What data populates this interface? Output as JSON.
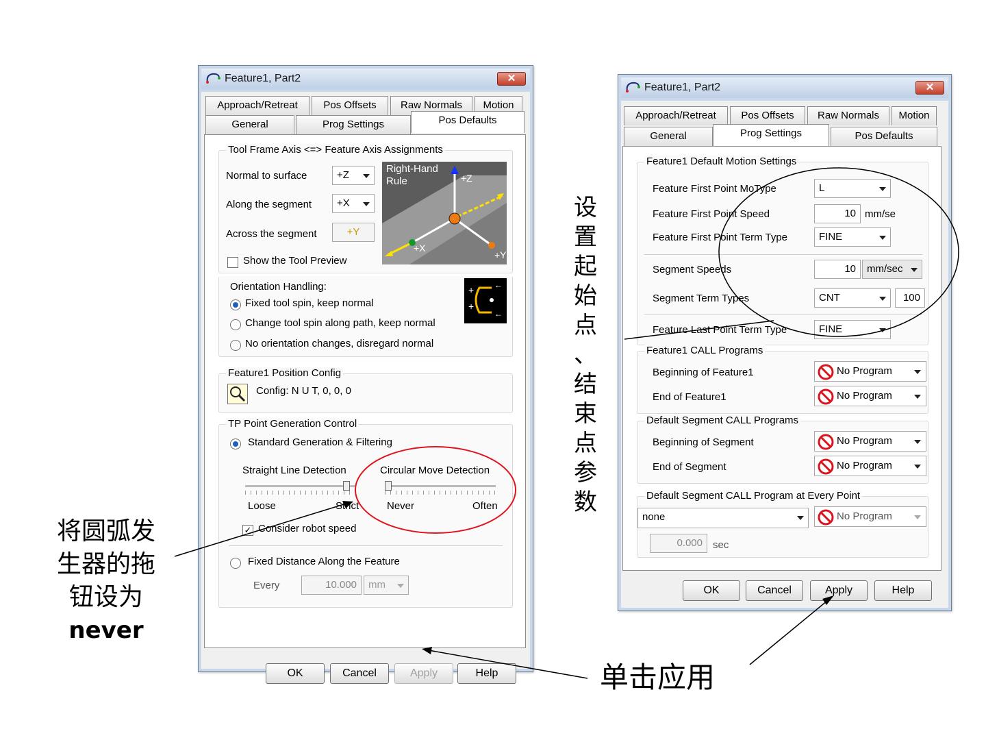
{
  "left_dialog": {
    "title": "Feature1, Part2",
    "close_label": "✕",
    "tabs_row1": [
      "Approach/Retreat",
      "Pos Offsets",
      "Raw Normals",
      "Motion"
    ],
    "tabs_row2": [
      "General",
      "Prog Settings",
      "Pos Defaults"
    ],
    "active_tab": "Pos Defaults",
    "axis_group": {
      "title": "Tool Frame Axis <=> Feature Axis Assignments",
      "normal_label": "Normal to surface",
      "normal_value": "+Z",
      "along_label": "Along the segment",
      "along_value": "+X",
      "across_label": "Across the segment",
      "across_value": "+Y",
      "show_preview_label": "Show the Tool Preview",
      "show_preview_checked": false,
      "rule_text1": "Right-Hand",
      "rule_text2": "Rule",
      "axis_z": "+Z",
      "axis_x": "+X",
      "axis_y": "+Y"
    },
    "orientation": {
      "title": "Orientation Handling:",
      "options": [
        "Fixed tool spin, keep normal",
        "Change tool spin along path, keep normal",
        "No orientation changes, disregard normal"
      ],
      "selected": 0
    },
    "position_config": {
      "title": "Feature1 Position Config",
      "value": "Config: N U T, 0, 0, 0"
    },
    "tp_generation": {
      "title": "TP Point Generation Control",
      "standard_label": "Standard Generation & Filtering",
      "straight_title": "Straight Line Detection",
      "straight_min": "Loose",
      "straight_max": "Strict",
      "straight_level": 0.95,
      "circular_title": "Circular Move Detection",
      "circular_min": "Never",
      "circular_max": "Often",
      "circular_level": 0.0,
      "consider_speed_label": "Consider robot speed",
      "consider_speed_checked": true,
      "fixed_distance_label": "Fixed Distance Along the Feature",
      "every_label": "Every",
      "every_value": "10.000",
      "every_unit": "mm"
    },
    "buttons": [
      "OK",
      "Cancel",
      "Apply",
      "Help"
    ]
  },
  "right_dialog": {
    "title": "Feature1, Part2",
    "close_label": "✕",
    "tabs_row1": [
      "Approach/Retreat",
      "Pos Offsets",
      "Raw Normals",
      "Motion"
    ],
    "tabs_row2": [
      "General",
      "Prog Settings",
      "Pos Defaults"
    ],
    "active_tab": "Prog Settings",
    "motion_group": {
      "title": "Feature1 Default Motion Settings",
      "first_motype_label": "Feature First Point MoType",
      "first_motype_value": "L",
      "first_speed_label": "Feature First Point Speed",
      "first_speed_value": "10",
      "first_speed_unit": "mm/se",
      "first_term_label": "Feature First Point Term Type",
      "first_term_value": "FINE",
      "seg_speed_label": "Segment Speeds",
      "seg_speed_value": "10",
      "seg_speed_unit": "mm/sec",
      "seg_term_label": "Segment Term Types",
      "seg_term_value": "CNT",
      "seg_term_cnt": "100",
      "last_term_label": "Feature Last Point Term Type",
      "last_term_value": "FINE"
    },
    "call_group": {
      "title": "Feature1 CALL Programs",
      "begin_label": "Beginning of Feature1",
      "end_label": "End of Feature1",
      "program": "No Program"
    },
    "seg_call_group": {
      "title": "Default Segment CALL Programs",
      "begin_label": "Beginning of Segment",
      "end_label": "End of Segment",
      "program": "No Program"
    },
    "every_point_group": {
      "title": "Default Segment CALL Program at Every Point",
      "select_value": "none",
      "program": "No Program",
      "time_value": "0.000",
      "time_unit": "sec"
    },
    "buttons": [
      "OK",
      "Cancel",
      "Apply",
      "Help"
    ]
  },
  "annotations": {
    "vertical_note": [
      "设",
      "置",
      "起",
      "始",
      "点",
      "、",
      "结",
      "束",
      "点",
      "参",
      "数"
    ],
    "left_note_lines": [
      "将圆弧发",
      "生器的拖",
      "钮设为"
    ],
    "left_note_bold": "never",
    "bottom_note": "单击应用"
  },
  "colors": {
    "ellipse_red": "#e0141e",
    "ellipse_black": "#000000",
    "radio_blue": "#1f5fbf",
    "close_red": "#c4402b"
  }
}
